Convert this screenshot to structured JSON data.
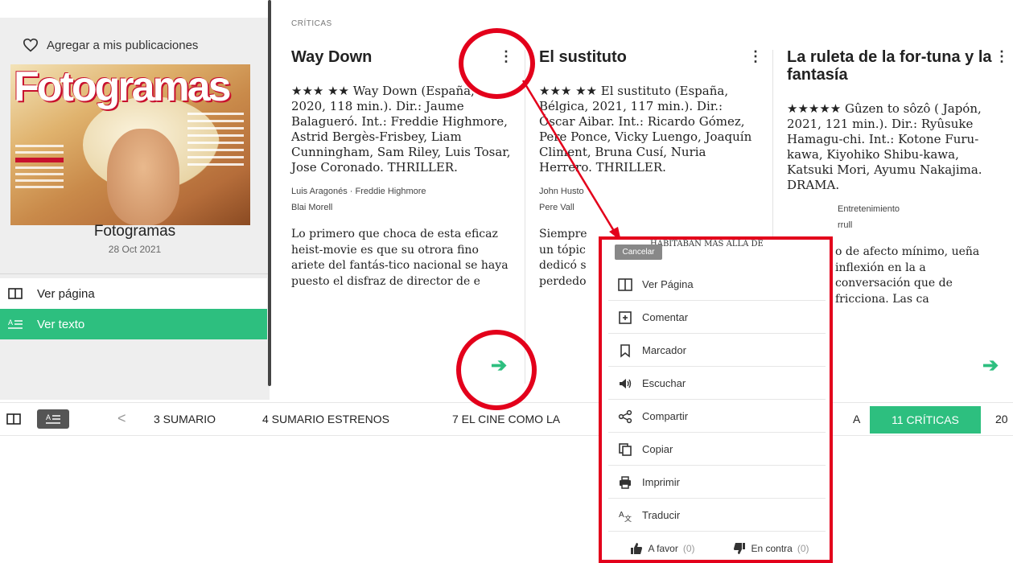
{
  "colors": {
    "accent": "#2dbf7f",
    "annotation_red": "#e3001b"
  },
  "sidebar": {
    "favorite_label": "Agregar a mis publicaciones",
    "cover_masthead": "Fotogramas",
    "magazine_title": "Fotogramas",
    "date": "28 Oct 2021",
    "menu": [
      {
        "label": "Ver página",
        "icon": "page-icon"
      },
      {
        "label": "Ver texto",
        "icon": "text-icon",
        "active": true
      }
    ]
  },
  "section_label": "CRÍTICAS",
  "articles": [
    {
      "title": "Way Down",
      "body": "★★★ ★★ Way Down (España, 2020, 118 min.). Dir.: Jaume Balagueró. Int.: Freddie Highmore, Astrid Bergès-Frisbey, Liam Cunningham, Sam Riley, Luis Tosar, Jose Coronado. THRILLER.",
      "authors_line1": "Luis Aragonés · Freddie Highmore",
      "authors_line2": "Blai Morell",
      "excerpt": "Lo primero que choca de esta eficaz heist-movie es que su otrora fino ariete del fantás-tico nacional se haya puesto el disfraz de director de e"
    },
    {
      "title": "El sustituto",
      "body": "★★★ ★★ El sustituto (España, Bélgica, 2021, 117 min.). Dir.: Óscar Aibar. Int.: Ricardo Gómez, Pere Ponce, Vicky Luengo, Joaquín Climent, Bruna Cusí, Nuria Herrero. THRILLER.",
      "authors_line1": "John Husto",
      "authors_line2": "Pere Vall",
      "excerpt": "Siempre un tópic dedicó s perdedo"
    },
    {
      "title": "La ruleta de la for-tuna y la fantasía",
      "body": "★★★★★ Gûzen to sôzô ( Japón, 2021, 121 min.). Dir.: Ryûsuke Hamagu-chi. Int.: Kotone Furu-kawa, Kiyohiko Shibu-kawa, Katsuki Mori, Ayumu Nakajima. DRAMA.",
      "authors_line1": "Entretenimiento",
      "authors_line2": "rrull",
      "excerpt": "o de afecto mínimo, ueña inflexión en la a conversación que de fricciona. Las ca"
    }
  ],
  "bottom_nav": {
    "prev": "<",
    "items": [
      "3 SUMARIO",
      "4 SUMARIO ESTRENOS",
      "7 EL CINE COMO LA",
      "A",
      "11 CRÍTICAS",
      "20"
    ]
  },
  "context_menu": {
    "behind_text": "HABITABAN MAS ALLA DE",
    "cancel": "Cancelar",
    "items": [
      {
        "label": "Ver Página",
        "icon": "page-icon"
      },
      {
        "label": "Comentar",
        "icon": "comment-icon"
      },
      {
        "label": "Marcador",
        "icon": "bookmark-icon"
      },
      {
        "label": "Escuchar",
        "icon": "speaker-icon"
      },
      {
        "label": "Compartir",
        "icon": "share-icon"
      },
      {
        "label": "Copiar",
        "icon": "copy-icon"
      },
      {
        "label": "Imprimir",
        "icon": "print-icon"
      },
      {
        "label": "Traducir",
        "icon": "translate-icon"
      }
    ],
    "vote_for": "A favor",
    "vote_for_count": "(0)",
    "vote_against": "En contra",
    "vote_against_count": "(0)"
  }
}
